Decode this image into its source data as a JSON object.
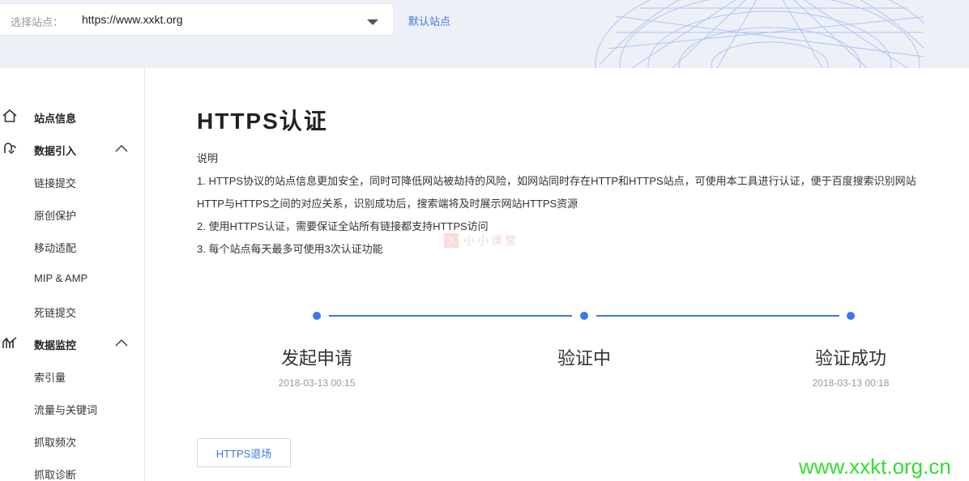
{
  "header": {
    "site_label": "选择站点：",
    "site_value": "https://www.xxkt.org",
    "default_site": "默认站点"
  },
  "sidebar": {
    "items": [
      {
        "label": "站点信息",
        "type": "group",
        "icon": "home-icon"
      },
      {
        "label": "数据引入",
        "type": "group",
        "icon": "data-import-icon",
        "expanded": true
      },
      {
        "label": "链接提交",
        "type": "item"
      },
      {
        "label": "原创保护",
        "type": "item"
      },
      {
        "label": "移动适配",
        "type": "item"
      },
      {
        "label": "MIP & AMP",
        "type": "item"
      },
      {
        "label": "死链提交",
        "type": "item"
      },
      {
        "label": "数据监控",
        "type": "group",
        "icon": "data-monitor-icon",
        "expanded": true
      },
      {
        "label": "索引量",
        "type": "item"
      },
      {
        "label": "流量与关键词",
        "type": "item"
      },
      {
        "label": "抓取频次",
        "type": "item"
      },
      {
        "label": "抓取诊断",
        "type": "item"
      }
    ]
  },
  "main": {
    "title": "HTTPS认证",
    "desc_heading": "说明",
    "desc_lines": [
      "1. HTTPS协议的站点信息更加安全，同时可降低网站被劫持的风险，如网站同时存在HTTP和HTTPS站点，可使用本工具进行认证，便于百度搜索识别网站",
      "HTTP与HTTPS之间的对应关系，识别成功后，搜索端将及时展示网站HTTPS资源",
      "2. 使用HTTPS认证，需要保证全站所有链接都支持HTTPS访问",
      "3. 每个站点每天最多可使用3次认证功能"
    ],
    "steps": [
      {
        "label": "发起申请",
        "time": "2018-03-13 00:15"
      },
      {
        "label": "验证中",
        "time": ""
      },
      {
        "label": "验证成功",
        "time": "2018-03-13 00:18"
      }
    ],
    "exit_button": "HTTPS退场"
  },
  "watermark": {
    "mark": "X",
    "text": "小小课堂"
  },
  "site_watermark": "www.xxkt.org.cn",
  "colors": {
    "accent": "#3b78e7",
    "topbar_bg": "#eef0f8",
    "watermark_green": "#33dd33"
  }
}
